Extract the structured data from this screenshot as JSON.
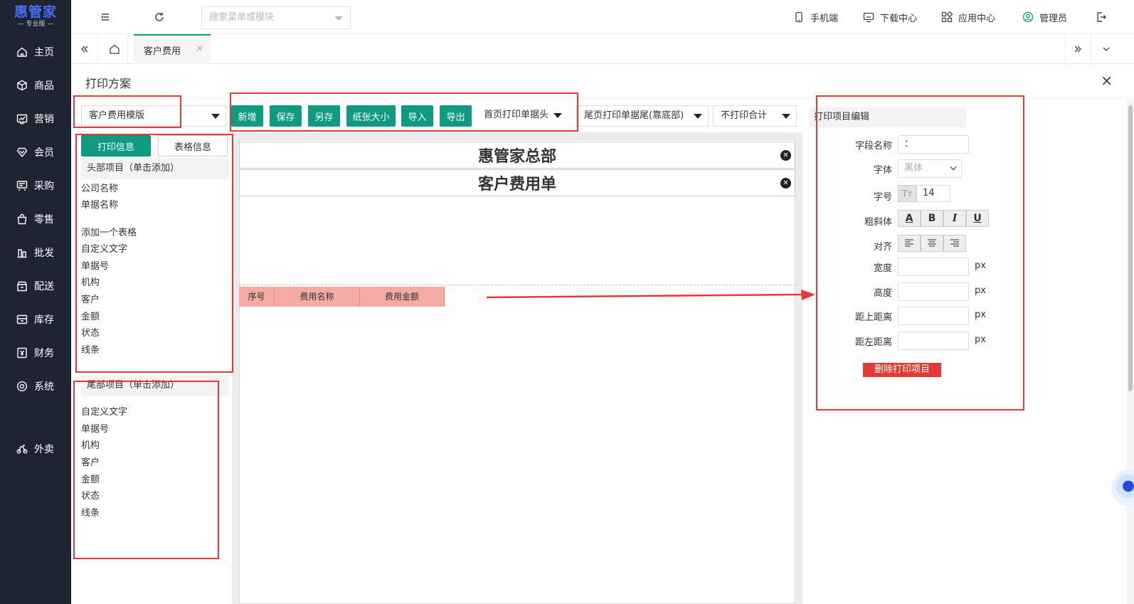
{
  "brand": {
    "name": "惠管家",
    "edition": "专业版"
  },
  "sidebar": {
    "items": [
      {
        "label": "主页",
        "icon": "home-icon"
      },
      {
        "label": "商品",
        "icon": "box-icon"
      },
      {
        "label": "营销",
        "icon": "chart-icon"
      },
      {
        "label": "会员",
        "icon": "member-icon"
      },
      {
        "label": "采购",
        "icon": "purchase-icon"
      },
      {
        "label": "零售",
        "icon": "retail-icon"
      },
      {
        "label": "批发",
        "icon": "wholesale-icon"
      },
      {
        "label": "配送",
        "icon": "delivery-icon"
      },
      {
        "label": "库存",
        "icon": "inventory-icon"
      },
      {
        "label": "财务",
        "icon": "finance-icon"
      },
      {
        "label": "系统",
        "icon": "settings-icon"
      },
      {
        "label": "外卖",
        "icon": "takeout-icon"
      }
    ]
  },
  "header": {
    "search_placeholder": "搜索菜单或模块",
    "mobile": "手机端",
    "download": "下载中心",
    "apps": "应用中心",
    "user": "管理员"
  },
  "tabs": {
    "active": "客户费用",
    "close": "×"
  },
  "page": {
    "title": "打印方案",
    "close": "×"
  },
  "toolbar": {
    "template": "客户费用模版",
    "add": "新增",
    "save": "保存",
    "save_as": "另存",
    "paper_size": "纸张大小",
    "import": "导入",
    "export": "导出",
    "first_page_header": "首页打印单据头",
    "last_page_footer": "尾页打印单据尾(靠底部)",
    "total": "不打印合计"
  },
  "left_panel": {
    "tab_print_info": "打印信息",
    "tab_table_info": "表格信息",
    "header_section": "头部项目（单击添加）",
    "header_items": [
      "公司名称",
      "单据名称"
    ],
    "body_items": [
      "添加一个表格",
      "自定义文字",
      "单据号",
      "机构",
      "客户",
      "金额",
      "状态",
      "线条"
    ],
    "footer_section": "尾部项目（单击添加）",
    "footer_items": [
      "自定义文字",
      "单据号",
      "机构",
      "客户",
      "金额",
      "状态",
      "线条"
    ]
  },
  "canvas": {
    "company_title": "惠管家总部",
    "doc_title": "客户费用单",
    "table_headers": [
      "序号",
      "费用名称",
      "费用金额"
    ]
  },
  "right_panel": {
    "title": "打印项目编辑",
    "field_name_label": "字段名称",
    "field_name_value": "：",
    "font_label": "字体",
    "font_value": "黑体",
    "size_label": "字号",
    "size_value": "14",
    "style_label": "粗斜体",
    "align_label": "对齐",
    "width_label": "宽度",
    "height_label": "高度",
    "top_label": "距上距离",
    "left_label": "距左距离",
    "unit": "px",
    "delete_button": "删除打印项目"
  },
  "colors": {
    "primary": "#0e9b82",
    "sidebar": "#1f2433",
    "annotation": "#e53935",
    "table_header": "#f5aaa4"
  }
}
